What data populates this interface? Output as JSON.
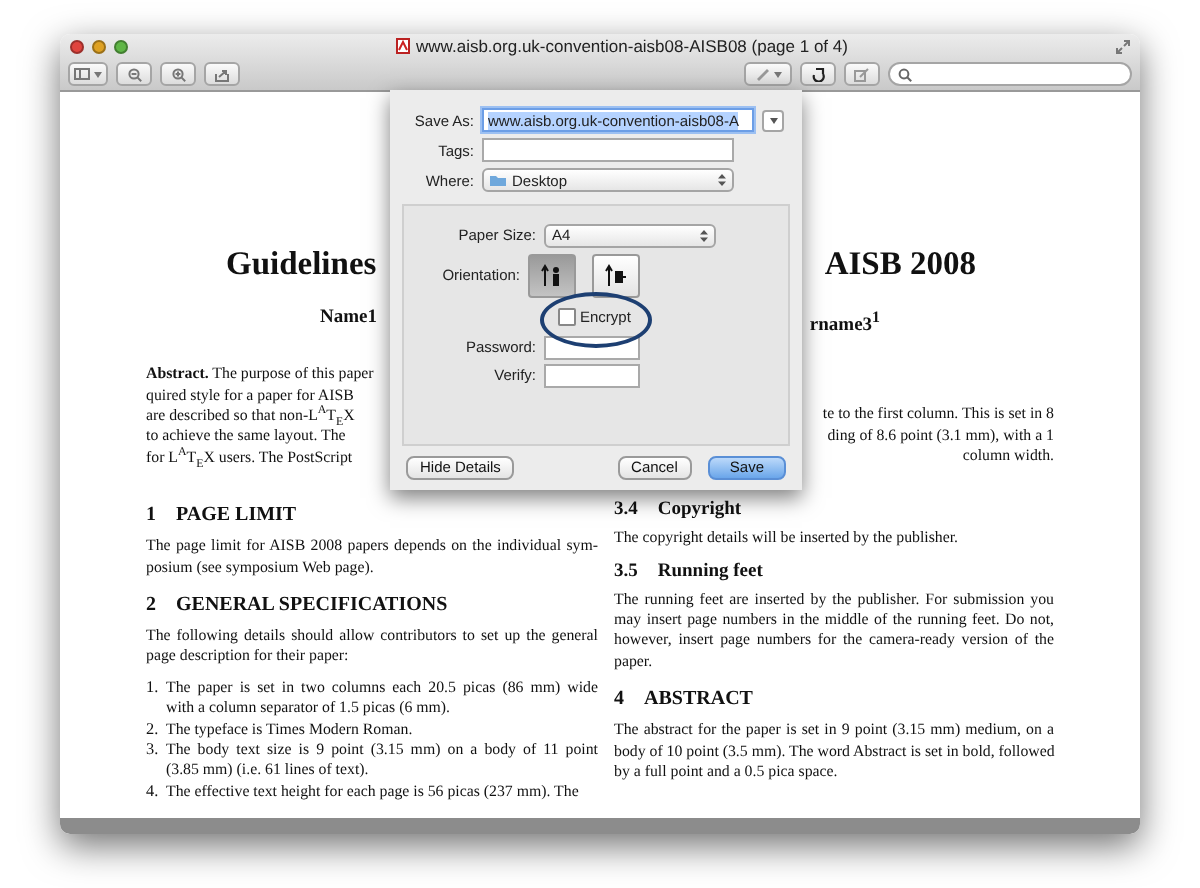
{
  "window": {
    "title": "www.aisb.org.uk-convention-aisb08-AISB08 (page 1 of 4)"
  },
  "document": {
    "title_parts": [
      "Guidelines",
      "AISB 2008"
    ],
    "author_parts": [
      "Name1",
      "rname3$^{1}$"
    ],
    "abstract_lines": [
      "**Abstract.** The purpose of this paper",
      "quired style for a paper for AISB",
      "are described so that non-L$^{A}$T$_{E}$X",
      "to achieve the same layout. The",
      "for L$^{A}$T$_{E}$X users. The PostScript"
    ],
    "affiliation_lines": [
      "te to the first column. This is set in 8",
      "ding of 8.6 point (3.1 mm), with a 1",
      "column width."
    ],
    "left_blocks": [
      {
        "kind": "heading",
        "number": "1",
        "text": "PAGE LIMIT"
      },
      {
        "kind": "paragraph",
        "lines": [
          "The page limit for AISB 2008 papers depends on the individual sym-",
          "posium (see symposium Web page)."
        ]
      },
      {
        "kind": "heading",
        "number": "2",
        "text": "GENERAL SPECIFICATIONS"
      },
      {
        "kind": "paragraph",
        "lines": [
          "The following details should allow contributors to set up the general",
          "page description for their paper:"
        ]
      },
      {
        "kind": "list",
        "items": [
          {
            "number": "1.",
            "lines": [
              "The paper is set in two columns each 20.5 picas (86 mm) wide",
              "with a column separator of 1.5 picas (6 mm)."
            ]
          },
          {
            "number": "2.",
            "lines": [
              "The typeface is Times Modern Roman."
            ]
          },
          {
            "number": "3.",
            "lines": [
              "The body text size is 9 point (3.15 mm) on a body of 11 point",
              "(3.85 mm) (i.e. 61 lines of text)."
            ]
          },
          {
            "number": "4.",
            "lines": [
              "The effective text height for each page is 56 picas (237 mm). The"
            ]
          }
        ]
      }
    ],
    "right_blocks": [
      {
        "kind": "subheading",
        "number": "3.4",
        "text": "Copyright"
      },
      {
        "kind": "paragraph",
        "lines": [
          "The copyright details will be inserted by the publisher."
        ]
      },
      {
        "kind": "subheading",
        "number": "3.5",
        "text": "Running feet"
      },
      {
        "kind": "paragraph",
        "lines": [
          "The running feet are inserted by the publisher. For submission you",
          "may insert page numbers in the middle of the running feet. Do not,",
          "however, insert page numbers for the camera-ready version of the",
          "paper."
        ]
      },
      {
        "kind": "heading",
        "number": "4",
        "text": "ABSTRACT"
      },
      {
        "kind": "paragraph",
        "lines": [
          "The abstract for the paper is set in 9 point (3.15 mm) medium, on a",
          "body of 10 point (3.5 mm). The word Abstract is set in bold, followed",
          "by a full point and a 0.5 pica space."
        ]
      }
    ]
  },
  "dialog": {
    "save_as": {
      "label": "Save As:",
      "value": "www.aisb.org.uk-convention-aisb08-A"
    },
    "tags": {
      "label": "Tags:"
    },
    "where": {
      "label": "Where:",
      "value": "Desktop"
    },
    "paper_size": {
      "label": "Paper Size:",
      "value": "A4"
    },
    "orientation": {
      "label": "Orientation:",
      "options": [
        {
          "kind": "portrait",
          "selected": true
        },
        {
          "kind": "landscape",
          "selected": false
        }
      ]
    },
    "encrypt": {
      "label": "Encrypt",
      "checked": false,
      "circled": true
    },
    "password": {
      "label": "Password:"
    },
    "verify": {
      "label": "Verify:"
    },
    "buttons": [
      {
        "label": "Hide Details",
        "kind": "normal"
      },
      {
        "label": "Cancel",
        "kind": "normal"
      },
      {
        "label": "Save",
        "kind": "default"
      }
    ]
  }
}
